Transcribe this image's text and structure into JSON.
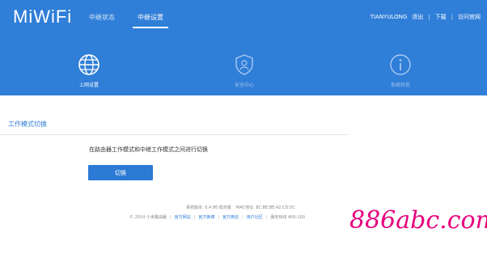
{
  "app": {
    "logo": "MiWiFi"
  },
  "topnav": {
    "items": [
      {
        "label": "中继状态",
        "active": false
      },
      {
        "label": "中继设置",
        "active": true
      }
    ]
  },
  "userbar": {
    "username": "TIANYULONG",
    "logout": "退出",
    "download": "下载",
    "official_site": "访问官网"
  },
  "subnav": {
    "items": [
      {
        "label": "上网设置",
        "icon": "globe-icon",
        "active": true
      },
      {
        "label": "安全中心",
        "icon": "shield-icon",
        "active": false
      },
      {
        "label": "系统状态",
        "icon": "info-icon",
        "active": false
      }
    ]
  },
  "main": {
    "section_title": "工作模式切换",
    "description": "在路由器工作模式和中继工作模式之间进行切换",
    "switch_button": "切换"
  },
  "footer": {
    "version_label": "系统版本: 0.4.86 稳定版",
    "mac_label": "MAC地址: 8C:BE:BE:42:CD:5C",
    "copyright": "© 2014 小米路由器",
    "links": [
      "官方网站",
      "官方微博",
      "官方微信",
      "用户社区"
    ],
    "hotline": "服务热线 400-100"
  },
  "watermark": {
    "text": "886abc.com"
  },
  "colors": {
    "brand_blue": "#2f7ed8",
    "button_blue": "#2b7ad4",
    "watermark_pink": "#e6007e"
  }
}
